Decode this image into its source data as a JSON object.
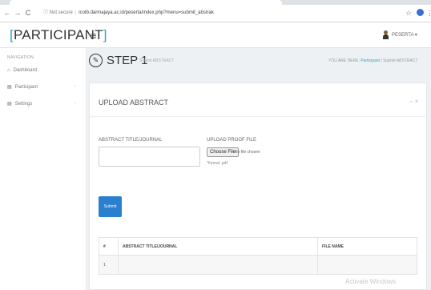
{
  "browser": {
    "back": "←",
    "forward": "→",
    "reload": "C",
    "security": "ⓘ Not secure",
    "url": "icotb.darmajaya.ac.id/peserta/index.php?menu=submit_abstrak",
    "star": "☆",
    "more": "⋮"
  },
  "header": {
    "brand_open": "[",
    "brand_text": "PARTICIPANT",
    "brand_close": "]",
    "menu_icon": "≡",
    "username": "PESERTA ▾"
  },
  "sidebar": {
    "heading": "NAVIGATION",
    "items": [
      {
        "icon": "⌂",
        "label": "Dashboard",
        "chevron": ""
      },
      {
        "icon": "▤",
        "label": "Participant",
        "chevron": "‹"
      },
      {
        "icon": "▤",
        "label": "Settings",
        "chevron": "‹"
      }
    ]
  },
  "page": {
    "step_icon": "✎",
    "step_title": "STEP 1",
    "step_subtitle": "Submit ABSTRACT",
    "breadcrumb_prefix": "YOU ARE HERE:",
    "breadcrumb_link": "Participant",
    "breadcrumb_sep": "/",
    "breadcrumb_current": "Submit ABSTRACT"
  },
  "panel": {
    "title": "UPLOAD ABSTRACT",
    "tools": "– ×",
    "field_title_label": "ABSTRACT TITLE/JOURNAL",
    "field_title_value": "",
    "field_file_label": "UPLOAD PROOF FILE",
    "file_button": "Choose File",
    "file_status": "No file chosen",
    "file_hint": "*format .pdf",
    "submit": "Submit"
  },
  "table": {
    "headers": [
      "#",
      "ABSTRACT TITLE/JOURNAL",
      "FILE NAME"
    ],
    "rows": [
      [
        "1",
        "",
        ""
      ]
    ]
  },
  "overlay": {
    "watermark": "Activate Windows"
  }
}
